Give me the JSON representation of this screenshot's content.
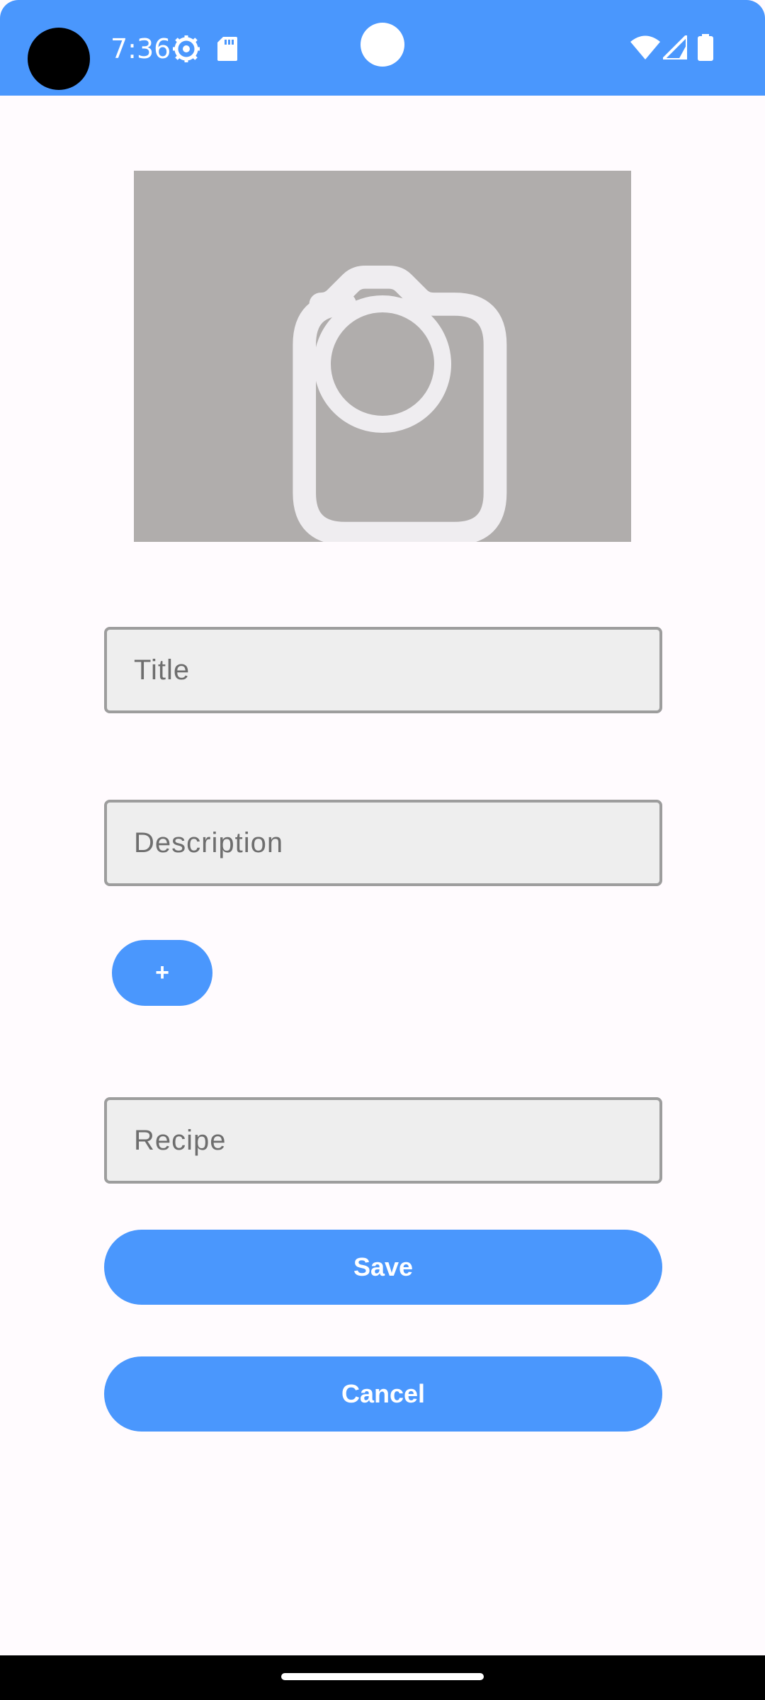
{
  "status_bar": {
    "time": "7:36",
    "icons": [
      "settings-gear-icon",
      "sd-card-icon",
      "wifi-icon",
      "cellular-signal-icon",
      "battery-icon"
    ],
    "color": "#4a97fd"
  },
  "photo": {
    "icon": "camera-icon",
    "background_color": "#b0adac"
  },
  "form": {
    "title_placeholder": "Title",
    "title_value": "",
    "description_placeholder": "Description",
    "description_value": "",
    "add_button_label": "+",
    "recipe_placeholder": "Recipe",
    "recipe_value": ""
  },
  "actions": {
    "save_label": "Save",
    "cancel_label": "Cancel"
  },
  "colors": {
    "accent": "#4a97fd",
    "background": "#fffbfe",
    "field_fill": "#eeeeee",
    "field_border": "#9d9d9d"
  }
}
